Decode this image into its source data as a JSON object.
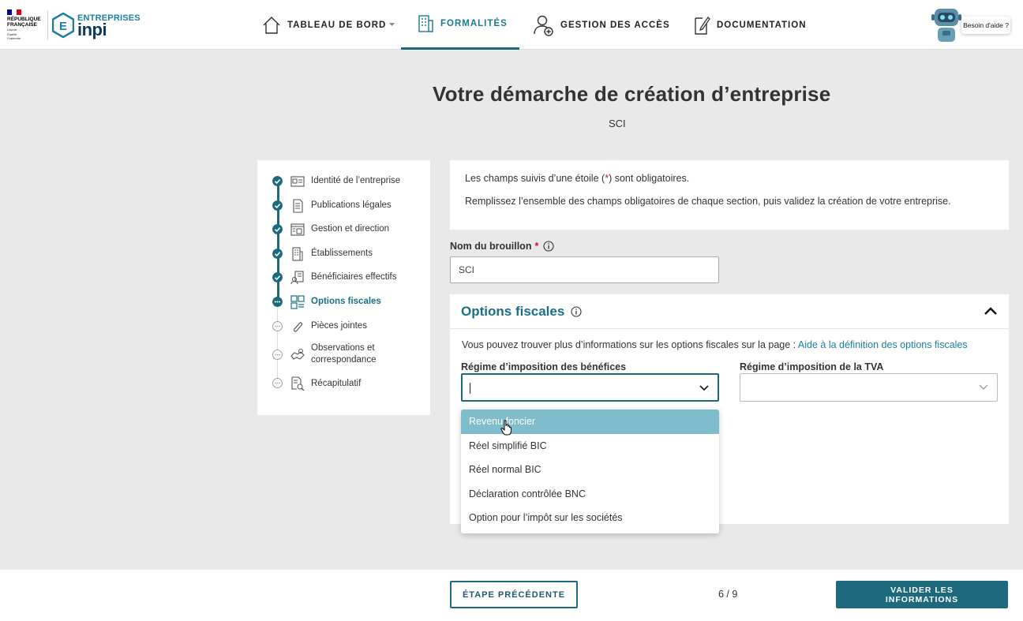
{
  "header": {
    "gov_brand": [
      "RÉPUBLIQUE",
      "FRANÇAISE"
    ],
    "gov_motto": [
      "Liberté",
      "Égalité",
      "Fraternité"
    ],
    "logo_top": "ENTREPRISES",
    "logo_name": "inpi",
    "nav": [
      {
        "label": "TABLEAU DE BORD",
        "icon": "home-icon",
        "has_dropdown": true,
        "active": false
      },
      {
        "label": "FORMALITÉS",
        "icon": "document-building-icon",
        "active": true
      },
      {
        "label": "GESTION DES ACCÈS",
        "icon": "user-add-icon",
        "active": false
      },
      {
        "label": "DOCUMENTATION",
        "icon": "document-edit-icon",
        "active": false
      }
    ],
    "help_label": "Besoin d'aide ?"
  },
  "page": {
    "title": "Votre démarche de création d’entreprise",
    "subtitle": "SCI"
  },
  "stepper": {
    "steps": [
      {
        "label": "Identité de l’entreprise",
        "status": "done",
        "icon": "id-card-icon"
      },
      {
        "label": "Publications légales",
        "status": "done",
        "icon": "newspaper-icon"
      },
      {
        "label": "Gestion et direction",
        "status": "done",
        "icon": "org-chart-icon"
      },
      {
        "label": "Établissements",
        "status": "done",
        "icon": "building-icon"
      },
      {
        "label": "Bénéficiaires effectifs",
        "status": "done",
        "icon": "beneficiary-icon"
      },
      {
        "label": "Options fiscales",
        "status": "current",
        "icon": "grid-icon"
      },
      {
        "label": "Pièces jointes",
        "status": "todo",
        "icon": "paperclip-icon"
      },
      {
        "label": "Observations et correspondance",
        "status": "todo",
        "icon": "handshake-icon"
      },
      {
        "label": "Récapitulatif",
        "status": "todo",
        "icon": "document-search-icon"
      }
    ]
  },
  "info": {
    "line1_pre": "Les champs suivis d’une étoile (",
    "line1_star": "*",
    "line1_post": ") sont obligatoires.",
    "line2": "Remplissez l’ensemble des champs obligatoires de chaque section, puis validez la création de votre entreprise."
  },
  "draft": {
    "label": "Nom du brouillon",
    "required": "*",
    "value": "SCI"
  },
  "fiscal": {
    "title": "Options fiscales",
    "info_text": "Vous pouvez trouver plus d’informations sur les options fiscales sur la page : ",
    "info_link": "Aide à la définition des options fiscales",
    "profit_label": "Régime d’imposition des bénéfices",
    "profit_value": "",
    "vat_label": "Régime d’imposition de la TVA",
    "vat_value": "",
    "options": [
      "Revenu foncier",
      "Réel simplifié BIC",
      "Réel normal BIC",
      "Déclaration contrôlée BNC",
      "Option pour l’impôt sur les sociétés"
    ],
    "hovered_option": 0
  },
  "footer": {
    "prev_label": "ÉTAPE PRÉCÉDENTE",
    "page_indicator": "6 / 9",
    "next_label": "VALIDER LES INFORMATIONS"
  },
  "colors": {
    "accent": "#1d6a7d",
    "link": "#1a7fa0",
    "hover_option": "#7fbccc",
    "required": "#c8102e"
  }
}
